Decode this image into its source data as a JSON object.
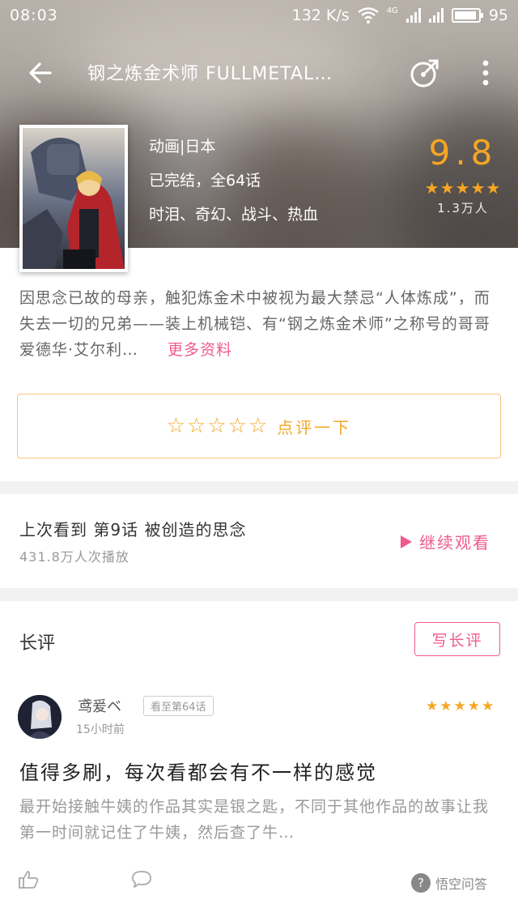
{
  "status_bar": {
    "time": "08:03",
    "net_speed": "132 K/s",
    "net_type": "4G",
    "battery": "95",
    "wifi_icon": "wifi-icon",
    "signal_icon": "signal-icon",
    "battery_icon": "battery-icon"
  },
  "header": {
    "title": "钢之炼金术师 FULLMETAL…",
    "back_icon": "arrow-left-icon",
    "share_icon": "share-icon",
    "more_icon": "more-vertical-icon"
  },
  "anime": {
    "category": "动画|日本",
    "status": "已完结，全64话",
    "tags": "时泪、奇幻、战斗、热血",
    "score": "9.8",
    "score_stars": "★★★★★",
    "rating_count": "1.3万人",
    "description": "因思念已故的母亲，触犯炼金术中被视为最大禁忌“人体炼成”，而失去一切的兄弟——装上机械铠、有“钢之炼金术师”之称号的哥哥爱德华·艾尔利…",
    "more_link": "更多资料"
  },
  "rate_box": {
    "stars": "☆☆☆☆☆",
    "label": "点评一下"
  },
  "progress": {
    "last_watched": "上次看到  第9话  被创造的思念",
    "play_count": "431.8万人次播放",
    "continue_label": "继续观看"
  },
  "reviews": {
    "section_title": "长评",
    "write_button": "写长评",
    "items": [
      {
        "username": "鸢爰ベ",
        "episode_badge": "看至第64话",
        "time_ago": "15小时前",
        "stars": "★★★★★",
        "title": "值得多刷，每次看都会有不一样的感觉",
        "body": "最开始接触牛姨的作品其实是银之匙，不同于其他作品的故事让我第一时间就记住了牛姨，然后查了牛…"
      }
    ]
  },
  "watermark": {
    "text": "悟空问答"
  },
  "colors": {
    "accent_pink": "#ef5b8c",
    "accent_orange": "#f6a623"
  }
}
